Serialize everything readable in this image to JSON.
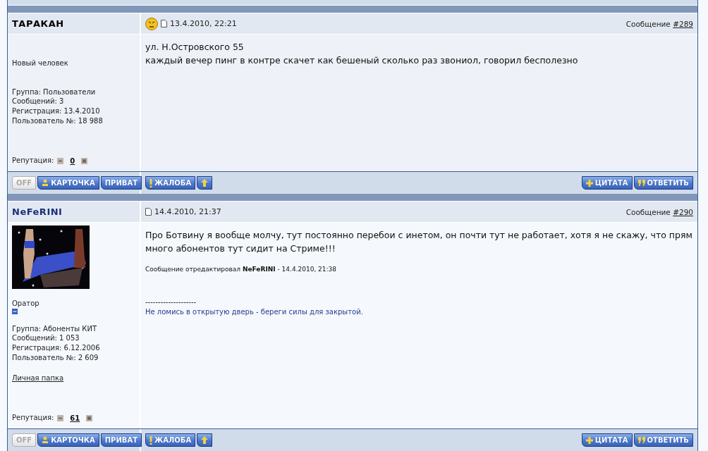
{
  "posts": [
    {
      "author": "ТАРАКАН",
      "color": "#000000",
      "mood": true,
      "date": "13.4.2010, 22:21",
      "number_label": "Сообщение",
      "number": "#289",
      "profile": {
        "title": "Новый человек",
        "stats": [
          "Группа: Пользователи",
          "Сообщений: 3",
          "Регистрация: 13.4.2010",
          "Пользователь №: 18 988"
        ],
        "reputation_label": "Репутация:",
        "reputation": "0"
      },
      "body": [
        "ул. Н.Островского 55",
        "каждый вечер пинг в контре скачет как бешеный сколько раз звониол, говорил бесполезно"
      ],
      "buttons_left": [
        {
          "kind": "status",
          "label": "OFF"
        },
        {
          "kind": "profile",
          "label": "КАРТОЧКА"
        },
        {
          "kind": "plain",
          "label": "ПРИВАТ"
        }
      ],
      "buttons_mid": [
        {
          "kind": "report",
          "label": "ЖАЛОБА"
        },
        {
          "kind": "top"
        }
      ],
      "buttons_right": [
        {
          "kind": "quote",
          "label": "ЦИТАТА"
        },
        {
          "kind": "reply",
          "label": "ОТВЕТИТЬ"
        }
      ]
    },
    {
      "author": "NeFeRINI",
      "color": "#1a2f7a",
      "date": "14.4.2010, 21:37",
      "number_label": "Сообщение",
      "number": "#290",
      "profile": {
        "title": "Оратор",
        "rank_icon": true,
        "stats": [
          "Группа: Абоненты КИТ",
          "Сообщений: 1 053",
          "Регистрация: 6.12.2006",
          "Пользователь №: 2 609"
        ],
        "link": "Личная папка",
        "reputation_label": "Репутация:",
        "reputation": "61"
      },
      "body": [
        "Про Ботвину я вообще молчу, тут постоянно перебои с инетом, он почти тут не работает, хотя я не скажу, что прям много абонентов тут сидит на Стриме!!!"
      ],
      "edit_note": "Сообщение отредактировал **NeFeRINI** - 14.4.2010, 21:38",
      "signature_rule": "--------------------",
      "signature": "Не ломись в открытую дверь - береги силы для закрытой.",
      "buttons_left": [
        {
          "kind": "status",
          "label": "OFF"
        },
        {
          "kind": "profile",
          "label": "КАРТОЧКА"
        },
        {
          "kind": "plain",
          "label": "ПРИВАТ"
        }
      ],
      "buttons_mid": [
        {
          "kind": "report",
          "label": "ЖАЛОБА"
        },
        {
          "kind": "top"
        }
      ],
      "buttons_right": [
        {
          "kind": "quote",
          "label": "ЦИТАТА"
        },
        {
          "kind": "reply",
          "label": "ОТВЕТИТЬ"
        }
      ]
    }
  ]
}
